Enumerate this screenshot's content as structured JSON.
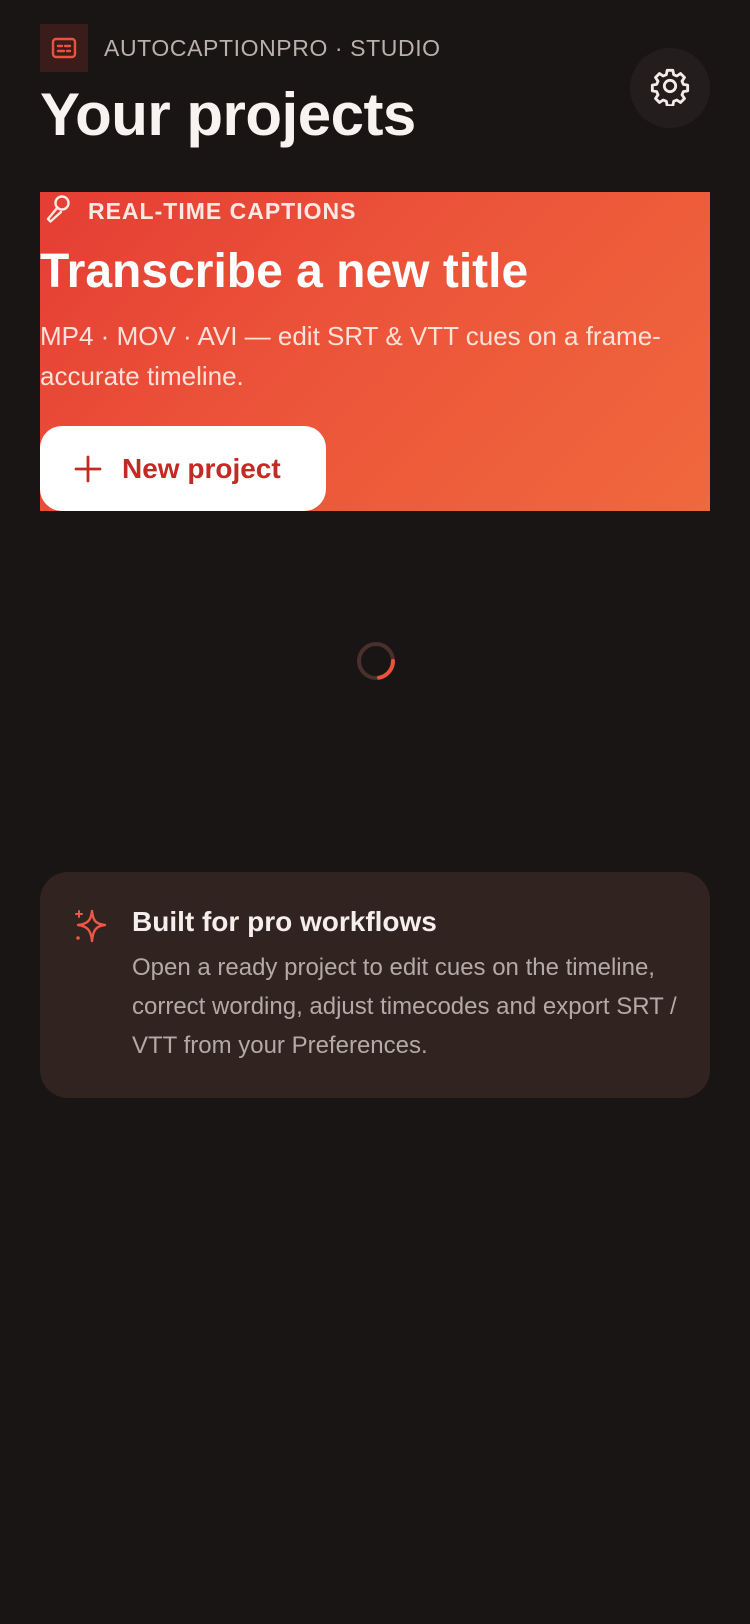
{
  "app": {
    "brand_name": "AUTOCAPTIONPRO · STUDIO",
    "brand_icon": "captions-icon",
    "settings_icon": "gear-icon"
  },
  "header": {
    "title": "Your projects"
  },
  "hero": {
    "tag_icon": "microphone-icon",
    "tag": "REAL-TIME CAPTIONS",
    "title": "Transcribe a new title",
    "subtitle": "MP4 · MOV · AVI — edit SRT & VTT cues on a frame-accurate timeline.",
    "button_icon": "plus-icon",
    "button_label": "New project"
  },
  "loading": {
    "icon": "loading-spinner-icon"
  },
  "info": {
    "icon": "sparkle-icon",
    "title": "Built for pro workflows",
    "text": "Open a ready project to edit cues on the timeline, correct wording, adjust timecodes and export SRT / VTT from your Preferences."
  },
  "colors": {
    "background": "#191514",
    "accent": "#e84a37",
    "hero_gradient_start": "#e53d34",
    "hero_gradient_end": "#f0683d",
    "card": "#302320",
    "button_text": "#c22b23"
  }
}
